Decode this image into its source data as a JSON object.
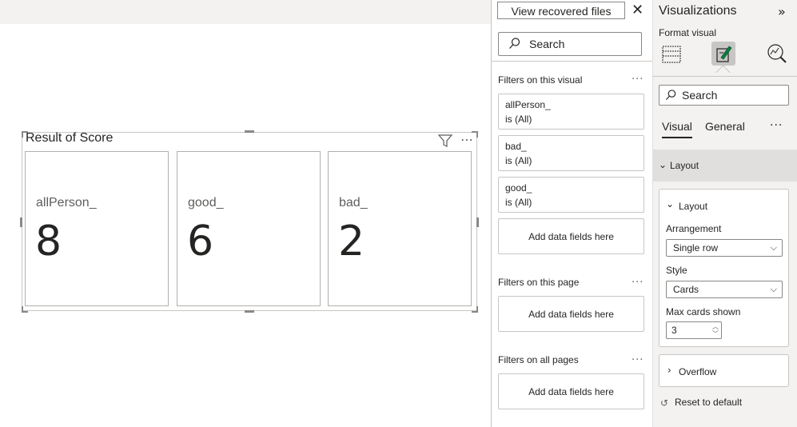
{
  "report": {
    "visual": {
      "title": "Result of Score",
      "cards": [
        {
          "label": "allPerson_",
          "value": "8"
        },
        {
          "label": "good_",
          "value": "6"
        },
        {
          "label": "bad_",
          "value": "2"
        }
      ]
    }
  },
  "filters": {
    "recovered_button": "View recovered files",
    "search_placeholder": "Search",
    "on_visual": {
      "heading": "Filters on this visual",
      "items": [
        {
          "name": "allPerson_",
          "state": "is (All)"
        },
        {
          "name": "bad_",
          "state": "is (All)"
        },
        {
          "name": "good_",
          "state": "is (All)"
        }
      ],
      "add_label": "Add data fields here"
    },
    "on_page": {
      "heading": "Filters on this page",
      "add_label": "Add data fields here"
    },
    "on_all_pages": {
      "heading": "Filters on all pages",
      "add_label": "Add data fields here"
    }
  },
  "visualizations": {
    "title": "Visualizations",
    "format_visual": "Format visual",
    "search_placeholder": "Search",
    "tabs": [
      "Visual",
      "General"
    ],
    "layout_group": "Layout",
    "layout_card": {
      "heading": "Layout",
      "arrangement_label": "Arrangement",
      "arrangement_value": "Single row",
      "style_label": "Style",
      "style_value": "Cards",
      "max_cards_label": "Max cards shown",
      "max_cards_value": "3"
    },
    "overflow": "Overflow",
    "reset": "Reset to default"
  }
}
